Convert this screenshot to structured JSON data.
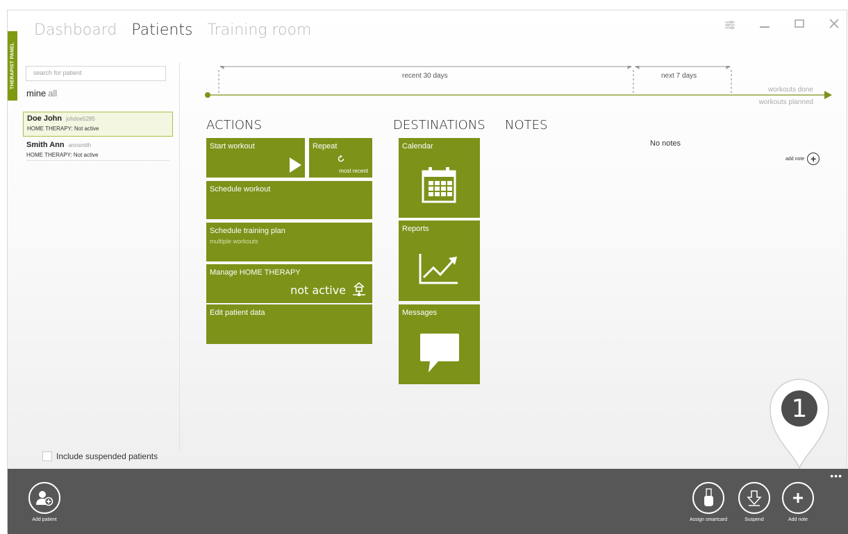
{
  "side_tab": "THERAPIST PANEL",
  "nav": {
    "dashboard": "Dashboard",
    "patients": "Patients",
    "training_room": "Training room"
  },
  "search": {
    "placeholder": "search for patient"
  },
  "filter": {
    "mine": "mine",
    "all": "all"
  },
  "patients": [
    {
      "name": "Doe John",
      "username": "johdoe5285",
      "status": "HOME THERAPY: Not active"
    },
    {
      "name": "Smith Ann",
      "username": "annsmith",
      "status": "HOME THERAPY: Not active"
    }
  ],
  "include_suspended": "Include suspended patients",
  "timeline": {
    "recent": "recent 30 days",
    "next": "next 7 days",
    "done": "workouts done",
    "planned": "workouts planned"
  },
  "actions": {
    "title": "ACTIONS",
    "start_workout": "Start workout",
    "repeat": "Repeat",
    "repeat_sub": "most recent",
    "schedule_workout": "Schedule workout",
    "schedule_plan": "Schedule training plan",
    "schedule_plan_sub": "multiple workouts",
    "manage_home": "Manage  HOME THERAPY",
    "manage_home_status": "not active",
    "edit_patient": "Edit patient data"
  },
  "destinations": {
    "title": "DESTINATIONS",
    "calendar": "Calendar",
    "reports": "Reports",
    "messages": "Messages"
  },
  "notes": {
    "title": "NOTES",
    "empty": "No notes",
    "add": "add note"
  },
  "bottom": {
    "add_patient": "Add patient",
    "assign_smartcard": "Assign smartcard",
    "suspend": "Suspend",
    "add_note": "Add note"
  },
  "callout": "1",
  "icons": [
    "settings-icon",
    "minimize-icon",
    "maximize-icon",
    "close-icon",
    "play-icon",
    "refresh-icon",
    "home-network-icon",
    "calendar-icon",
    "chart-icon",
    "speech-bubble-icon",
    "add-user-icon",
    "smartcard-icon",
    "download-arrow-icon",
    "plus-icon",
    "more-icon"
  ],
  "colors": {
    "accent": "#7c9219",
    "bar": "#575757"
  }
}
